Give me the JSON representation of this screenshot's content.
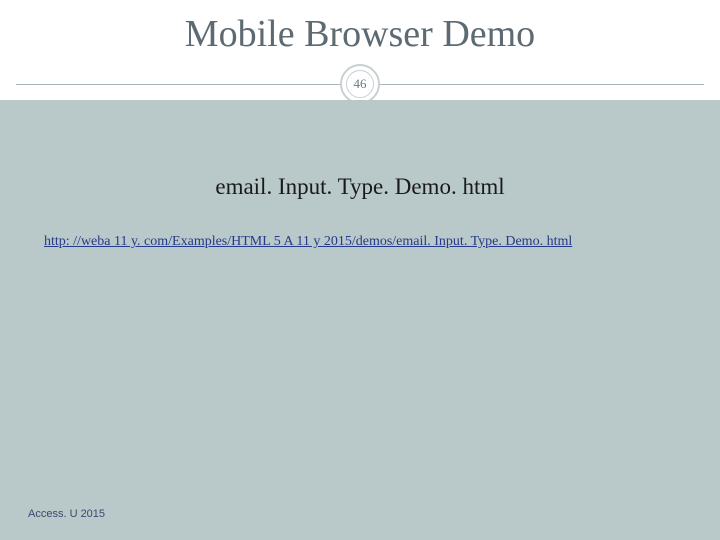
{
  "title": "Mobile Browser Demo",
  "page_number": "46",
  "subtitle": "email. Input. Type. Demo. html",
  "link": "http: //weba 11 y. com/Examples/HTML 5 A 11 y 2015/demos/email. Input. Type. Demo. html",
  "footer": "Access. U 2015"
}
